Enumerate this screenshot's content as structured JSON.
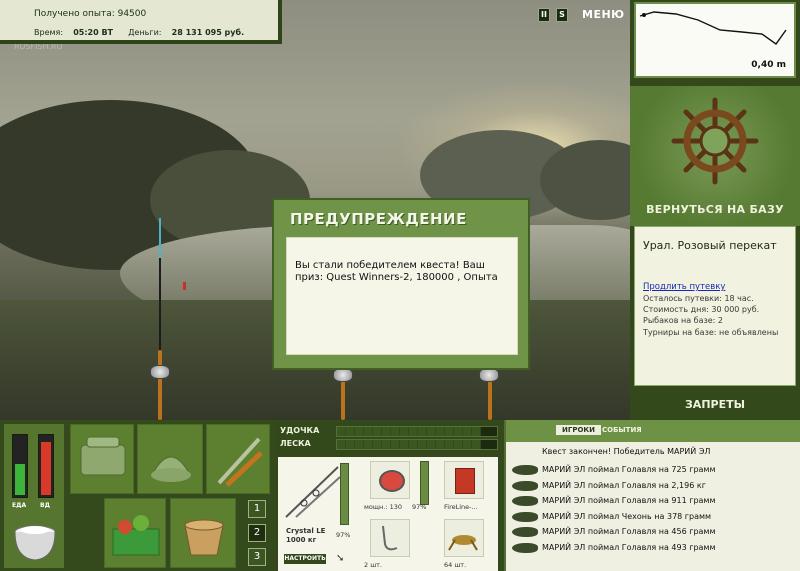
{
  "hud": {
    "experience_label": "Получено опыта: 94500",
    "time_label": "Время:",
    "time_value": "05:20 ВТ",
    "money_label": "Деньги:",
    "money_value": "28 131 095 руб."
  },
  "topbar": {
    "pause": "II",
    "sound": "S",
    "menu": "МЕНЮ"
  },
  "scene": {
    "watermark": "RUSFISH.RU"
  },
  "depth": {
    "value": "0,40 m"
  },
  "base": {
    "back_label": "ВЕРНУТЬСЯ НА БАЗУ",
    "location": "Урал. Розовый перекат",
    "extend_link": "Продлить путевку",
    "lines": [
      "Осталось путевки: 18 час.",
      "Стоимость дня: 30 000 руб.",
      "Рыбаков на базе: 2",
      "Турниры на базе: не объявлены"
    ],
    "forbid_label": "ЗАПРЕТЫ"
  },
  "dialog": {
    "title": "ПРЕДУПРЕЖДЕНИЕ",
    "message": "Вы стали победителем квеста! Ваш приз: Quest Winners-2, 180000 , Опыта"
  },
  "meters": {
    "food_label": "ЕДА",
    "vodka_label": "ВД",
    "food_level": 0.55,
    "vodka_level": 0.95
  },
  "bait_tabs": [
    "1",
    "2",
    "3"
  ],
  "tackle": {
    "rod_label": "УДОЧКА",
    "line_label": "ЛЕСКА",
    "rod_name": "Crystal LE",
    "rod_weight": "1000 кг",
    "rod_percent": "97%",
    "reel_caption": "мощн.: 130",
    "reel_percent": "97%",
    "line_caption": "FireLine-...",
    "hook_caption": "2 шт.",
    "bait_caption": "64 шт.",
    "tune_button": "НАСТРОИТЬ"
  },
  "events": {
    "tab_players": "ИГРОКИ",
    "tab_events": "СОБЫТИЯ",
    "header": "Квест закончен! Победитель МАРИЙ ЭЛ",
    "rows": [
      "МАРИЙ ЭЛ поймал Голавля на 725 грамм",
      "МАРИЙ ЭЛ поймал Голавля на 2,196 кг",
      "МАРИЙ ЭЛ поймал Голавля на 911 грамм",
      "МАРИЙ ЭЛ поймал Чехонь на 378 грамм",
      "МАРИЙ ЭЛ поймал Голавля на 456 грамм",
      "МАРИЙ ЭЛ поймал Голавля на 493 грамм"
    ]
  },
  "colors": {
    "panel_green": "#6f9447",
    "dark_green": "#33491b",
    "meter_food": "#3bb53a",
    "meter_vodka": "#d83a2a",
    "rod_orange": "#b8731c"
  }
}
